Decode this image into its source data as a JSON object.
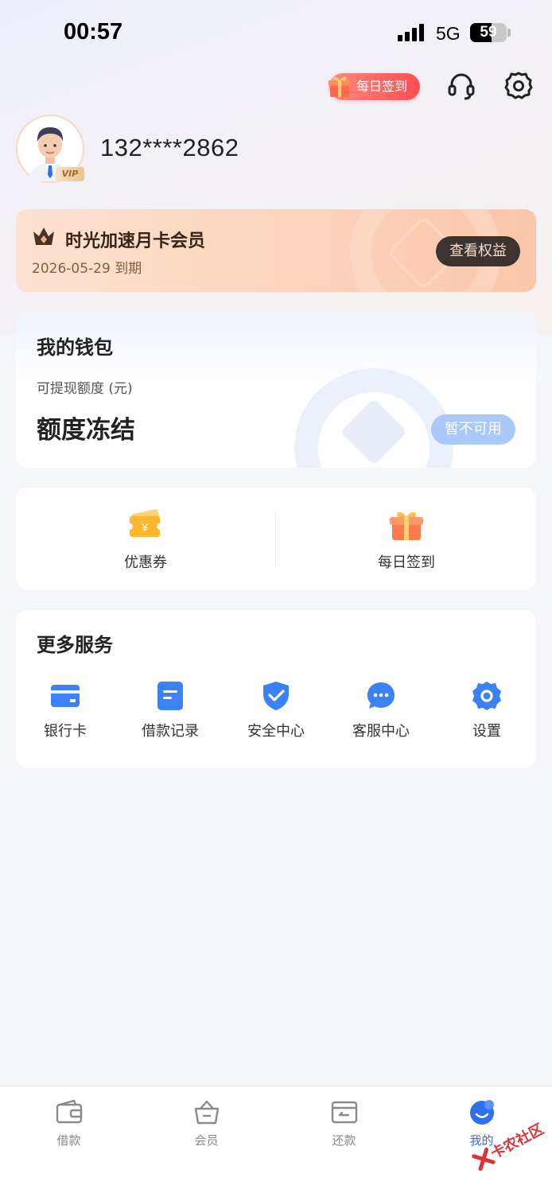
{
  "status_bar": {
    "time": "00:57",
    "network": "5G",
    "battery": "59",
    "battery_level": 0.59
  },
  "header": {
    "daily_signin_label": "每日签到",
    "icons": [
      "gift-icon",
      "headset-icon",
      "settings-gear-icon"
    ]
  },
  "profile": {
    "phone": "132****2862",
    "vip_badge": "VIP"
  },
  "membership": {
    "title": "时光加速月卡会员",
    "expire": "2026-05-29 到期",
    "button": "查看权益"
  },
  "wallet": {
    "title": "我的钱包",
    "subtitle": "可提现额度 (元)",
    "amount": "额度冻结",
    "button": "暂不可用"
  },
  "quick_actions": [
    {
      "label": "优惠券",
      "icon": "coupon-icon"
    },
    {
      "label": "每日签到",
      "icon": "gift-box-icon"
    }
  ],
  "services": {
    "title": "更多服务",
    "items": [
      {
        "label": "银行卡",
        "icon": "bank-card-icon"
      },
      {
        "label": "借款记录",
        "icon": "document-icon"
      },
      {
        "label": "安全中心",
        "icon": "shield-check-icon"
      },
      {
        "label": "客服中心",
        "icon": "chat-bubble-icon"
      },
      {
        "label": "设置",
        "icon": "gear-icon"
      }
    ]
  },
  "tabbar": {
    "items": [
      {
        "label": "借款",
        "icon": "wallet-icon"
      },
      {
        "label": "会员",
        "icon": "basket-icon"
      },
      {
        "label": "还款",
        "icon": "card-return-icon"
      },
      {
        "label": "我的",
        "icon": "profile-face-icon"
      }
    ],
    "active": "我的"
  },
  "watermark": {
    "text": "卡农社区"
  },
  "colors": {
    "accent": "#2f6ff2",
    "service_icon": "#3b82f6",
    "member_card": "#fcd3bc",
    "signin_pill": "#ff5a5f"
  }
}
